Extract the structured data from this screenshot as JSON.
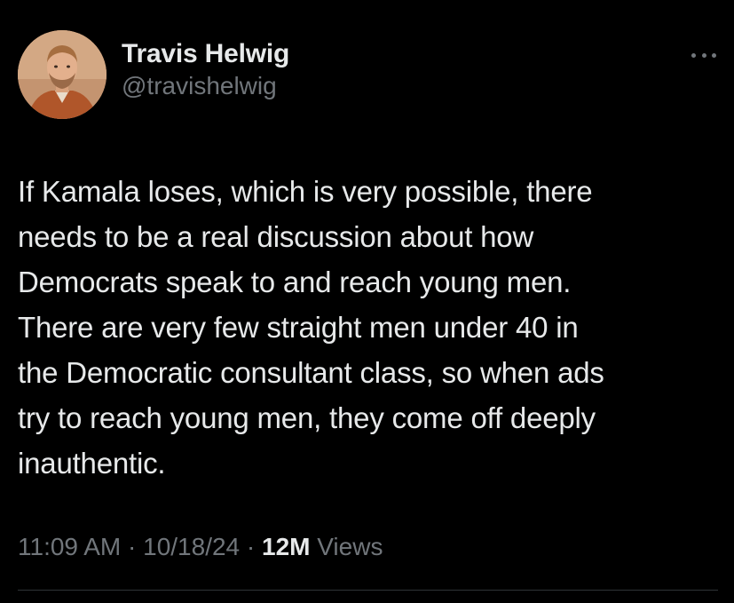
{
  "author": {
    "display_name": "Travis Helwig",
    "handle": "@travishelwig"
  },
  "tweet": {
    "text": "If Kamala loses, which is very possible, there\nneeds to be a real discussion about how\nDemocrats speak to and reach young men.\nThere are very few straight men under 40 in\nthe Democratic consultant class, so when ads\ntry to reach young men, they come off deeply\ninauthentic.",
    "time": "11:09 AM",
    "separator": "·",
    "date": "10/18/24",
    "views_count": "12M",
    "views_label": "Views"
  },
  "icons": {
    "more": "more-horizontal-icon",
    "avatar": "profile-photo"
  },
  "colors": {
    "background": "#000000",
    "primary_text": "#e7e9ea",
    "secondary_text": "#71767b",
    "divider": "#2f3336"
  }
}
